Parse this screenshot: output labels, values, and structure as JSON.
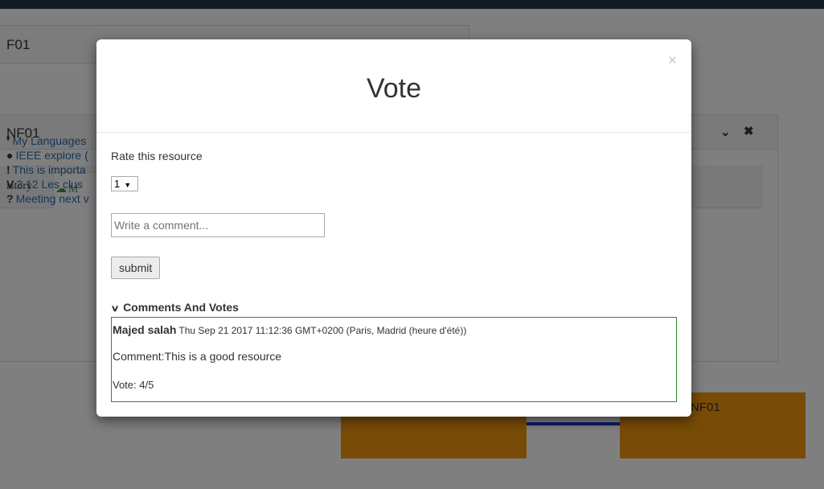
{
  "background": {
    "panel1": {
      "title": "F01",
      "close_glyph": "×"
    },
    "panel2": {
      "title": "NF01",
      "chevron_glyph": "⌄",
      "close_glyph": "✖"
    },
    "tabs": [
      {
        "label": "istory"
      },
      {
        "label": "M",
        "icon": "cloud-icon"
      }
    ],
    "list_items": [
      {
        "glyph": "❜",
        "label": "My Languages"
      },
      {
        "glyph": "●",
        "label": "IEEE explore ("
      },
      {
        "glyph": "!",
        "label": "This is importa"
      },
      {
        "glyph": "V",
        "label": "2.12 Les clus"
      },
      {
        "glyph": "?",
        "label": "Meeting next v"
      }
    ],
    "node_label": "NF01",
    "colors": {
      "node": "#f0960c",
      "connector": "#1a33c8",
      "topbar": "#243447"
    }
  },
  "modal": {
    "title": "Vote",
    "close_glyph": "×",
    "rate_label": "Rate this resource",
    "rate_selected": "1",
    "comment_placeholder": "Write a comment...",
    "submit_label": "submit",
    "comments_header": "Comments And Votes",
    "comments": [
      {
        "author": "Majed salah",
        "date": "Thu Sep 21 2017 11:12:36 GMT+0200 (Paris, Madrid (heure d'été))",
        "comment": "Comment:This is a good resource",
        "vote": "Vote: 4/5"
      }
    ]
  }
}
